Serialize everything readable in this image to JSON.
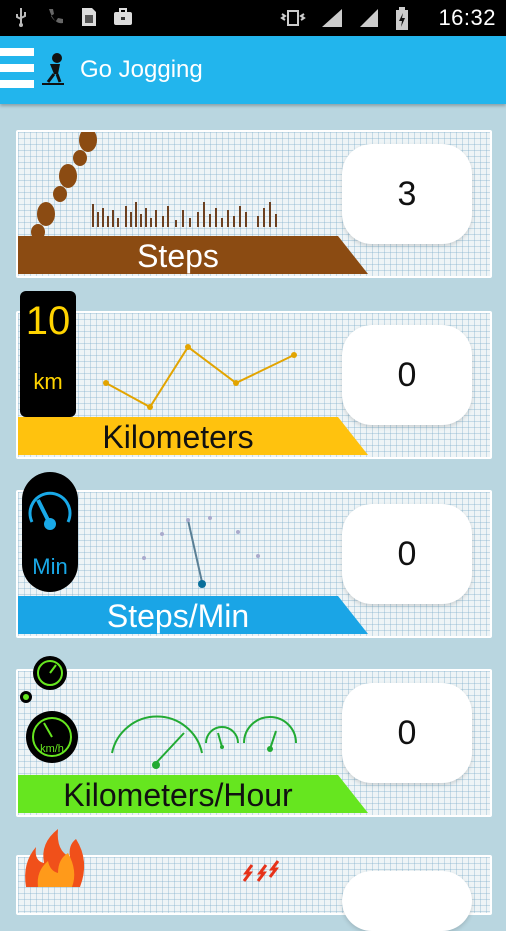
{
  "status_bar": {
    "time": "16:32"
  },
  "app_bar": {
    "title": "Go Jogging"
  },
  "cards": [
    {
      "label": "Steps",
      "value": "3",
      "color": "#8b4b12"
    },
    {
      "label": "Kilometers",
      "value": "0",
      "color": "#ffc20e",
      "icon_top": "10",
      "icon_bottom": "km"
    },
    {
      "label": "Steps/Min",
      "value": "0",
      "color": "#1aa5e6",
      "icon_text": "Min"
    },
    {
      "label": "Kilometers/Hour",
      "value": "0",
      "color": "#66e61f",
      "icon_text": "km/h"
    }
  ]
}
